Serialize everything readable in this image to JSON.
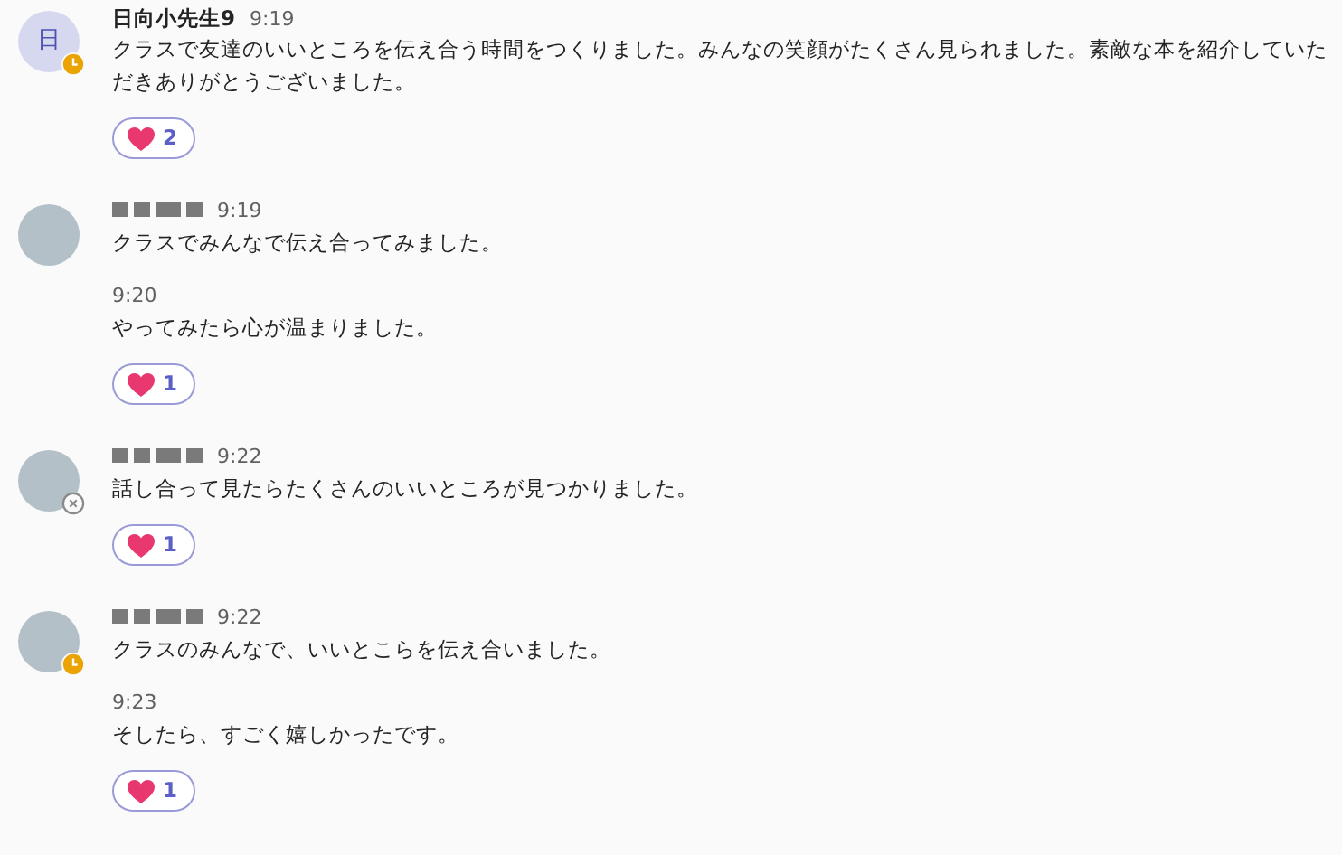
{
  "messages": [
    {
      "avatar": {
        "kind": "initial",
        "text": "日"
      },
      "away": true,
      "offline": false,
      "author": "日向小先生9",
      "posts": [
        {
          "time": "9:19",
          "text": "クラスで友達のいいところを伝え合う時間をつくりました。みんなの笑顔がたくさん見られました。素敵な本を紹介していただきありがとうございました。"
        }
      ],
      "reactions": [
        {
          "count": "2"
        }
      ]
    },
    {
      "avatar": {
        "kind": "photo"
      },
      "away": false,
      "offline": false,
      "redacted_name": true,
      "posts": [
        {
          "time": "9:19",
          "text": "クラスでみんなで伝え合ってみました。"
        },
        {
          "time": "9:20",
          "text": "やってみたら心が温まりました。"
        }
      ],
      "reactions": [
        {
          "count": "1"
        }
      ]
    },
    {
      "avatar": {
        "kind": "photo"
      },
      "away": false,
      "offline": true,
      "redacted_name": true,
      "posts": [
        {
          "time": "9:22",
          "text": "話し合って見たらたくさんのいいところが見つかりました。"
        }
      ],
      "reactions": [
        {
          "count": "1"
        }
      ]
    },
    {
      "avatar": {
        "kind": "photo"
      },
      "away": true,
      "offline": false,
      "redacted_name": true,
      "posts": [
        {
          "time": "9:22",
          "text": "クラスのみんなで、いいとこらを伝え合いました。"
        },
        {
          "time": "9:23",
          "text": "そしたら、すごく嬉しかったです。"
        }
      ],
      "reactions": [
        {
          "count": "1"
        }
      ]
    }
  ]
}
